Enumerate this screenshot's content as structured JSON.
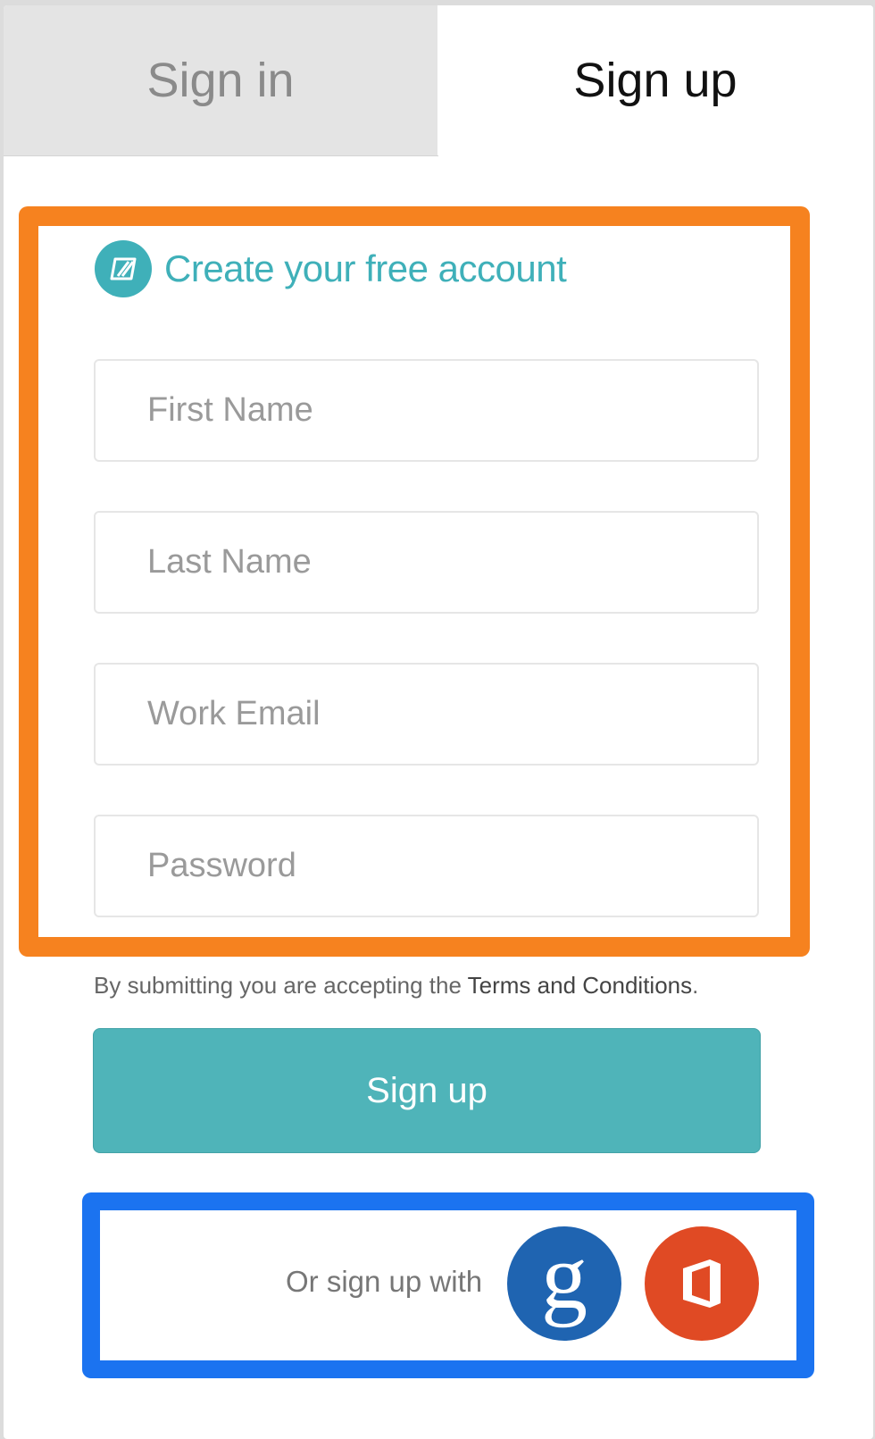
{
  "tabs": {
    "signin_label": "Sign in",
    "signup_label": "Sign up"
  },
  "form": {
    "title": "Create your free account",
    "first_name_placeholder": "First Name",
    "last_name_placeholder": "Last Name",
    "email_placeholder": "Work Email",
    "password_placeholder": "Password"
  },
  "terms": {
    "prefix": "By submitting you are accepting the ",
    "link": "Terms and Conditions",
    "suffix": "."
  },
  "submit_label": "Sign up",
  "social": {
    "label": "Or sign up with",
    "google_glyph": "g",
    "icons": [
      "google-icon",
      "office-icon"
    ]
  },
  "colors": {
    "accent": "#3fb0b9",
    "button": "#4fb4b9",
    "highlight_orange": "#f6821f",
    "highlight_blue": "#1b73f0",
    "google": "#1f64b1",
    "office": "#e04a24"
  }
}
